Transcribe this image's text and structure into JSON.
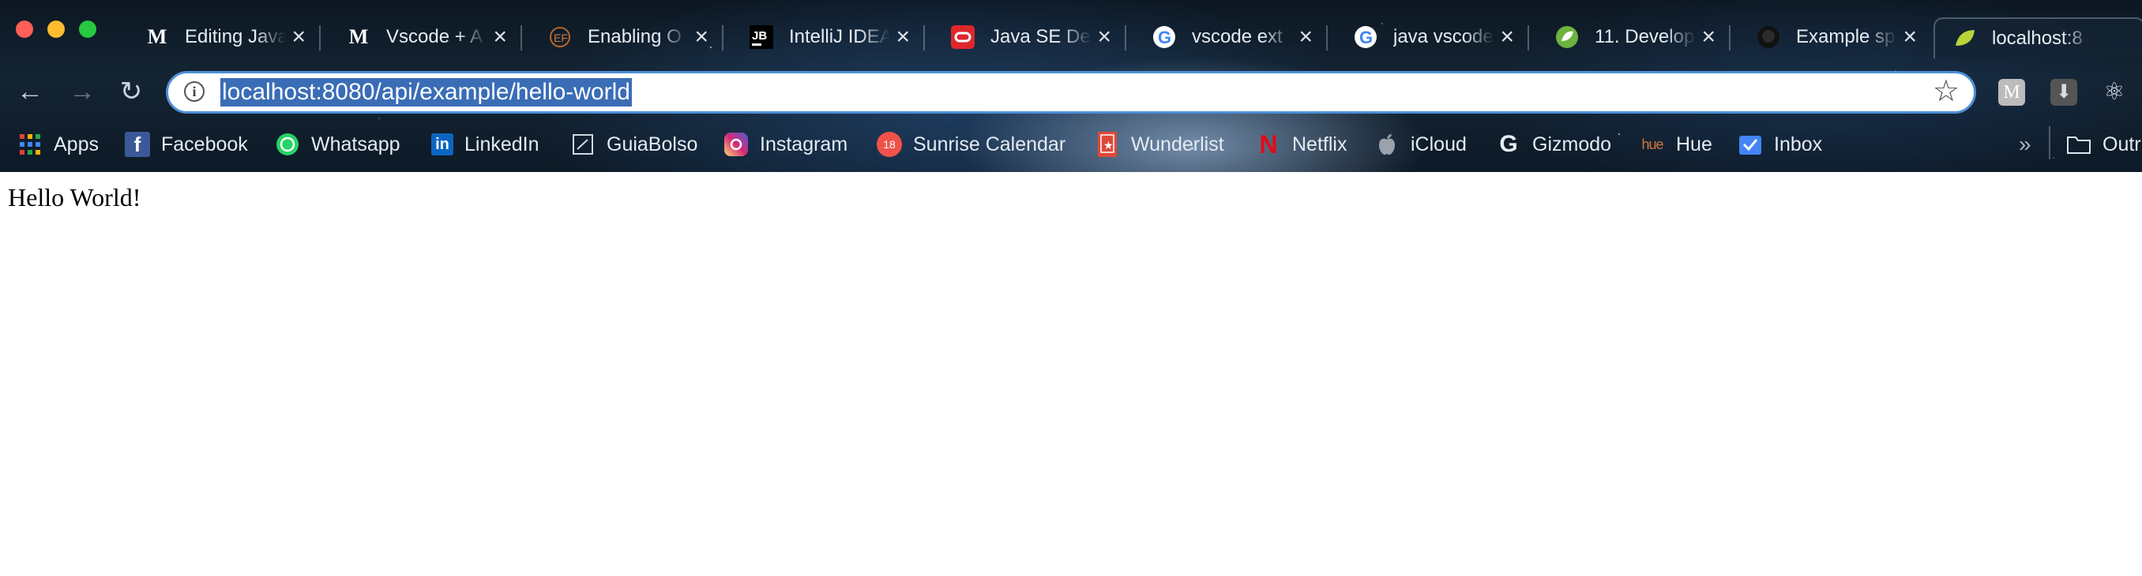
{
  "window": {
    "traffic_lights": [
      {
        "name": "close",
        "color": "#ff5f57"
      },
      {
        "name": "minimize",
        "color": "#febc2e"
      },
      {
        "name": "zoom",
        "color": "#28c840"
      }
    ]
  },
  "tabs": [
    {
      "title": "Editing Java",
      "favicon": "medium-icon",
      "active": false
    },
    {
      "title": "Vscode + A",
      "favicon": "medium-icon",
      "active": false
    },
    {
      "title": "Enabling O",
      "favicon": "ef-icon",
      "active": false
    },
    {
      "title": "IntelliJ IDEA",
      "favicon": "jetbrains-icon",
      "active": false
    },
    {
      "title": "Java SE De",
      "favicon": "oracle-icon",
      "active": false
    },
    {
      "title": "vscode ext",
      "favicon": "google-icon",
      "active": false
    },
    {
      "title": "java vscode",
      "favicon": "google-icon",
      "active": false
    },
    {
      "title": "11. Develop",
      "favicon": "spring-icon",
      "active": false
    },
    {
      "title": "Example sp",
      "favicon": "github-icon",
      "active": false
    },
    {
      "title": "localhost:8",
      "favicon": "spring-icon",
      "active": true
    }
  ],
  "toolbar": {
    "back": "←",
    "forward": "→",
    "reload": "↻",
    "info": "i",
    "star": "☆",
    "url": "localhost:8080/api/example/hello-world"
  },
  "extensions": [
    {
      "name": "medium-extension-icon",
      "label": "M"
    },
    {
      "name": "download-extension-icon",
      "label": "⬇"
    },
    {
      "name": "react-devtools-icon",
      "label": "⚛"
    }
  ],
  "bookmarks": [
    {
      "label": "Apps",
      "icon": "apps-grid-icon"
    },
    {
      "label": "Facebook",
      "icon": "facebook-icon"
    },
    {
      "label": "Whatsapp",
      "icon": "whatsapp-icon"
    },
    {
      "label": "LinkedIn",
      "icon": "linkedin-icon"
    },
    {
      "label": "GuiaBolso",
      "icon": "guiabolso-icon"
    },
    {
      "label": "Instagram",
      "icon": "instagram-icon"
    },
    {
      "label": "Sunrise Calendar",
      "icon": "sunrise-calendar-icon",
      "badge": "18"
    },
    {
      "label": "Wunderlist",
      "icon": "wunderlist-icon"
    },
    {
      "label": "Netflix",
      "icon": "netflix-icon"
    },
    {
      "label": "iCloud",
      "icon": "apple-icon"
    },
    {
      "label": "Gizmodo",
      "icon": "gizmodo-icon"
    },
    {
      "label": "Hue",
      "icon": "hue-icon",
      "icon_text": "hue"
    },
    {
      "label": "Inbox",
      "icon": "inbox-icon"
    }
  ],
  "bookmarks_overflow": "»",
  "other_bookmarks": {
    "label": "Outr",
    "icon": "folder-icon"
  },
  "page": {
    "body_text": "Hello World!"
  }
}
